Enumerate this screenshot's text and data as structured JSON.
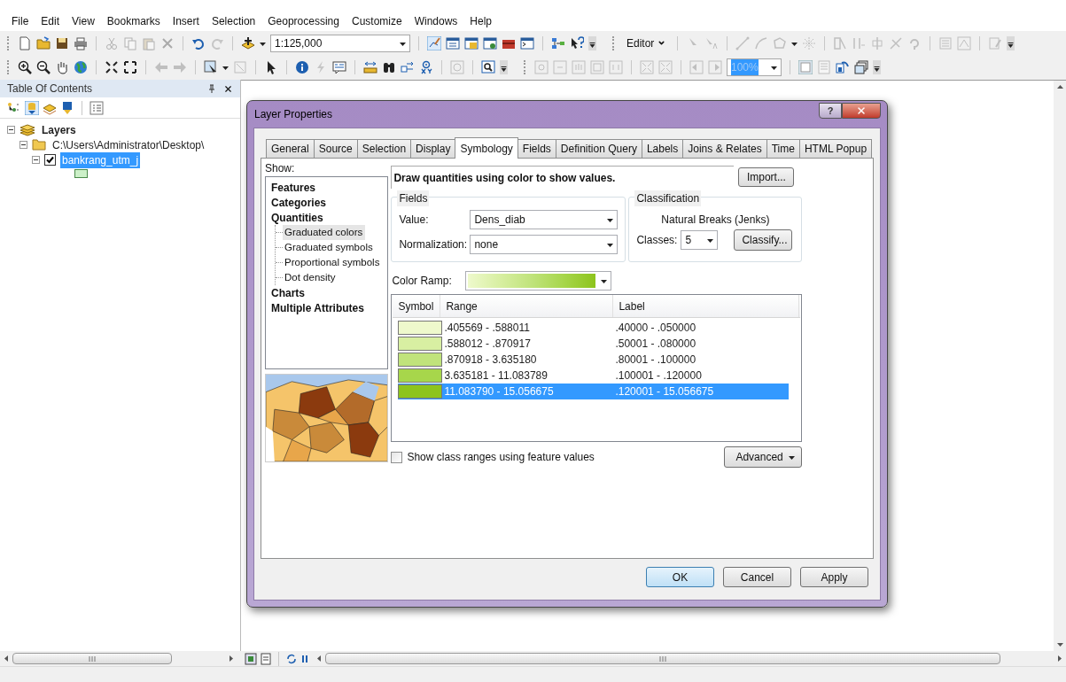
{
  "menu": [
    "File",
    "Edit",
    "View",
    "Bookmarks",
    "Insert",
    "Selection",
    "Geoprocessing",
    "Customize",
    "Windows",
    "Help"
  ],
  "toolbar": {
    "scale": "1:125,000",
    "editor": "Editor",
    "zoom": "100%"
  },
  "toc": {
    "title": "Table Of Contents",
    "tree": [
      {
        "label": "Layers",
        "kind": "frame",
        "expanded": true,
        "children": [
          {
            "label": "C:\\Users\\Administrator\\Desktop\\",
            "kind": "folder",
            "expanded": true,
            "children": [
              {
                "label": "bankrang_utm_j",
                "kind": "layer",
                "expanded": true,
                "checked": true,
                "selected": true
              }
            ]
          }
        ]
      }
    ]
  },
  "dialog": {
    "title": "Layer Properties",
    "help": "?",
    "tabs": [
      {
        "label": "General",
        "selected": false
      },
      {
        "label": "Source",
        "selected": false
      },
      {
        "label": "Selection",
        "selected": false
      },
      {
        "label": "Display",
        "selected": false
      },
      {
        "label": "Symbology",
        "selected": true
      },
      {
        "label": "Fields",
        "selected": false
      },
      {
        "label": "Definition Query",
        "selected": false
      },
      {
        "label": "Labels",
        "selected": false
      },
      {
        "label": "Joins & Relates",
        "selected": false
      },
      {
        "label": "Time",
        "selected": false
      },
      {
        "label": "HTML Popup",
        "selected": false
      }
    ],
    "show_label": "Show:",
    "show_tree": [
      {
        "label": "Features",
        "selected": false
      },
      {
        "label": "Categories",
        "selected": false
      },
      {
        "label": "Quantities",
        "selected": false,
        "children": [
          {
            "label": "Graduated colors",
            "selected": true
          },
          {
            "label": "Graduated symbols",
            "selected": false
          },
          {
            "label": "Proportional symbols",
            "selected": false
          },
          {
            "label": "Dot density",
            "selected": false
          }
        ]
      },
      {
        "label": "Charts",
        "selected": false
      },
      {
        "label": "Multiple Attributes",
        "selected": false
      }
    ],
    "description": "Draw quantities using color to show values.",
    "import": "Import...",
    "fields": {
      "title": "Fields",
      "value_label": "Value:",
      "value": "Dens_diab",
      "normalization_label": "Normalization:",
      "normalization": "none"
    },
    "classification": {
      "title": "Classification",
      "method": "Natural Breaks (Jenks)",
      "classes_label": "Classes:",
      "classes": "5",
      "classify": "Classify..."
    },
    "color_ramp": {
      "label": "Color Ramp:"
    },
    "table": {
      "columns": [
        "Symbol",
        "Range",
        "Label"
      ],
      "rows": [
        {
          "color": "#eef9cc",
          "range": ".405569 - .588011",
          "label": ".40000 - .050000",
          "selected": false
        },
        {
          "color": "#d8efa2",
          "range": ".588012 - .870917",
          "label": ".50001 - .080000",
          "selected": false
        },
        {
          "color": "#c0e37b",
          "range": ".870918 - 3.635180",
          "label": ".80001 - .100000",
          "selected": false
        },
        {
          "color": "#a7d64b",
          "range": "3.635181 - 11.083789",
          "label": ".100001 - .120000",
          "selected": false
        },
        {
          "color": "#8dc41c",
          "range": "11.083790 - 15.056675",
          "label": ".120001 - 15.056675",
          "selected": true
        }
      ]
    },
    "show_ranges": {
      "label": "Show class ranges using feature values",
      "checked": false
    },
    "advanced": "Advanced",
    "buttons": [
      {
        "label": "OK",
        "kind": "default"
      },
      {
        "label": "Cancel",
        "kind": "normal"
      },
      {
        "label": "Apply",
        "kind": "normal"
      }
    ]
  }
}
